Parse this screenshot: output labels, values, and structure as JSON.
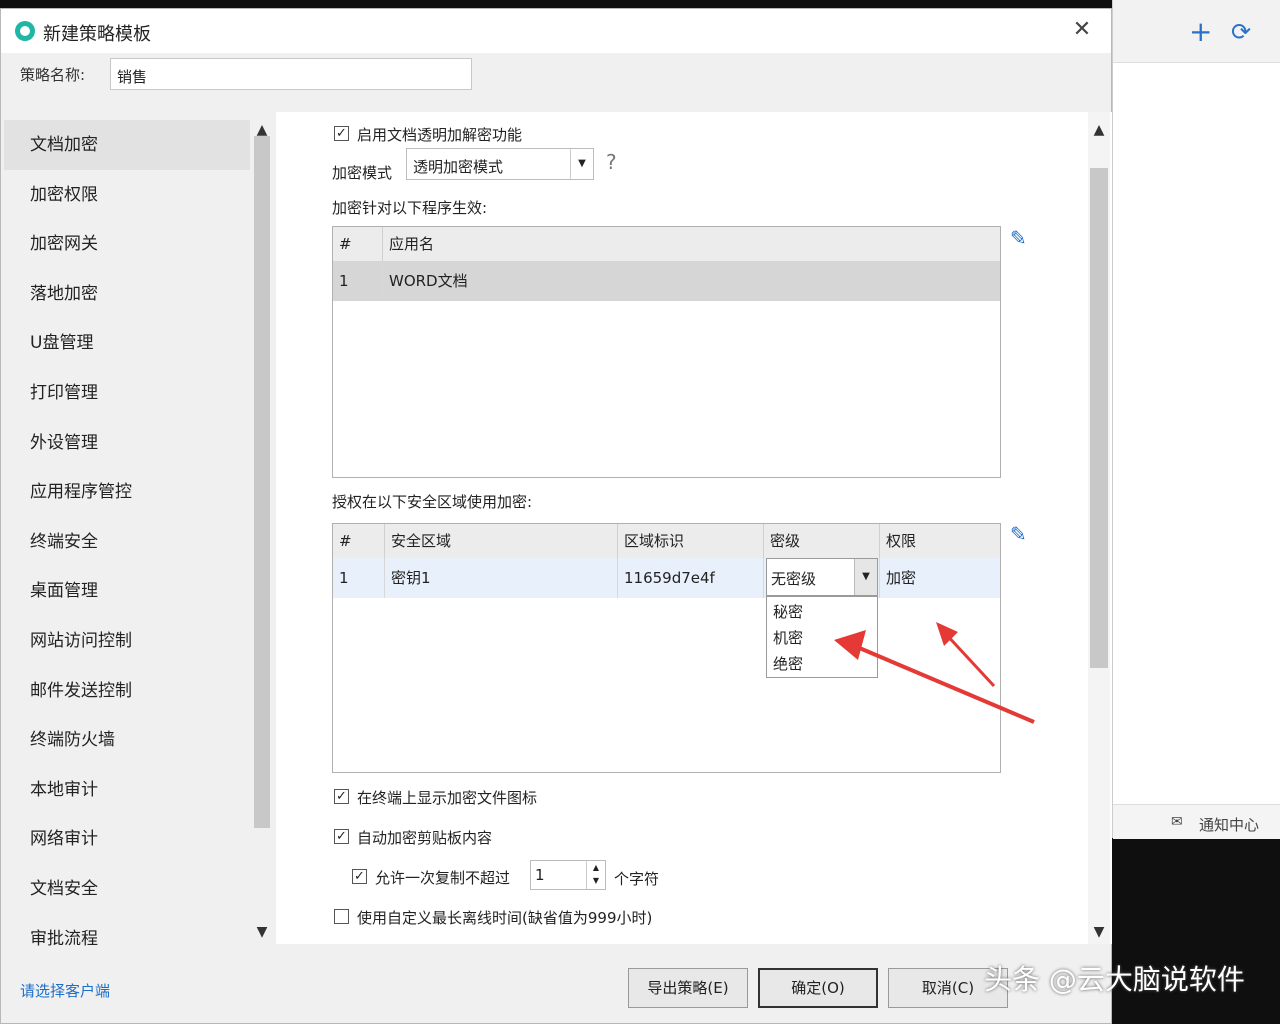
{
  "background_app": {
    "add_icon": "plus-icon",
    "refresh_icon": "refresh-icon",
    "notify_label": "通知中心"
  },
  "dialog": {
    "title": "新建策略模板",
    "name_label": "策略名称:",
    "name_value": "销售"
  },
  "sidebar": {
    "items": [
      {
        "label": "文档加密",
        "selected": true
      },
      {
        "label": "加密权限"
      },
      {
        "label": "加密网关"
      },
      {
        "label": "落地加密"
      },
      {
        "label": "U盘管理"
      },
      {
        "label": "打印管理"
      },
      {
        "label": "外设管理"
      },
      {
        "label": "应用程序管控"
      },
      {
        "label": "终端安全"
      },
      {
        "label": "桌面管理"
      },
      {
        "label": "网站访问控制"
      },
      {
        "label": "邮件发送控制"
      },
      {
        "label": "终端防火墙"
      },
      {
        "label": "本地审计"
      },
      {
        "label": "网络审计"
      },
      {
        "label": "文档安全"
      },
      {
        "label": "审批流程"
      }
    ]
  },
  "content": {
    "enable_label": "启用文档透明加解密功能",
    "mode_label": "加密模式",
    "mode_value": "透明加密模式",
    "help": "?",
    "apps_caption": "加密针对以下程序生效:",
    "apps_table": {
      "headers": [
        "#",
        "应用名"
      ],
      "rows": [
        [
          "1",
          "WORD文档"
        ]
      ]
    },
    "zones_caption": "授权在以下安全区域使用加密:",
    "zones_table": {
      "headers": [
        "#",
        "安全区域",
        "区域标识",
        "密级",
        "权限"
      ],
      "rows": [
        [
          "1",
          "密钥1",
          "11659d7e4f",
          "无密级",
          "加密"
        ]
      ]
    },
    "level_options": [
      "秘密",
      "机密",
      "绝密"
    ],
    "show_icon_label": "在终端上显示加密文件图标",
    "clipboard_label": "自动加密剪贴板内容",
    "copy_limit_label": "允许一次复制不超过",
    "copy_limit_value": "1",
    "chars_label": "个字符",
    "offline_label": "使用自定义最长离线时间(缺省值为999小时)"
  },
  "footer": {
    "link": "请选择客户端",
    "export": "导出策略(E)",
    "ok": "确定(O)",
    "cancel": "取消(C)"
  },
  "watermark": "头条 @云大脑说软件",
  "colors": {
    "accent": "#1e6fc8",
    "annotation_arrow": "#e53935",
    "logo": "#1fb6a5"
  }
}
